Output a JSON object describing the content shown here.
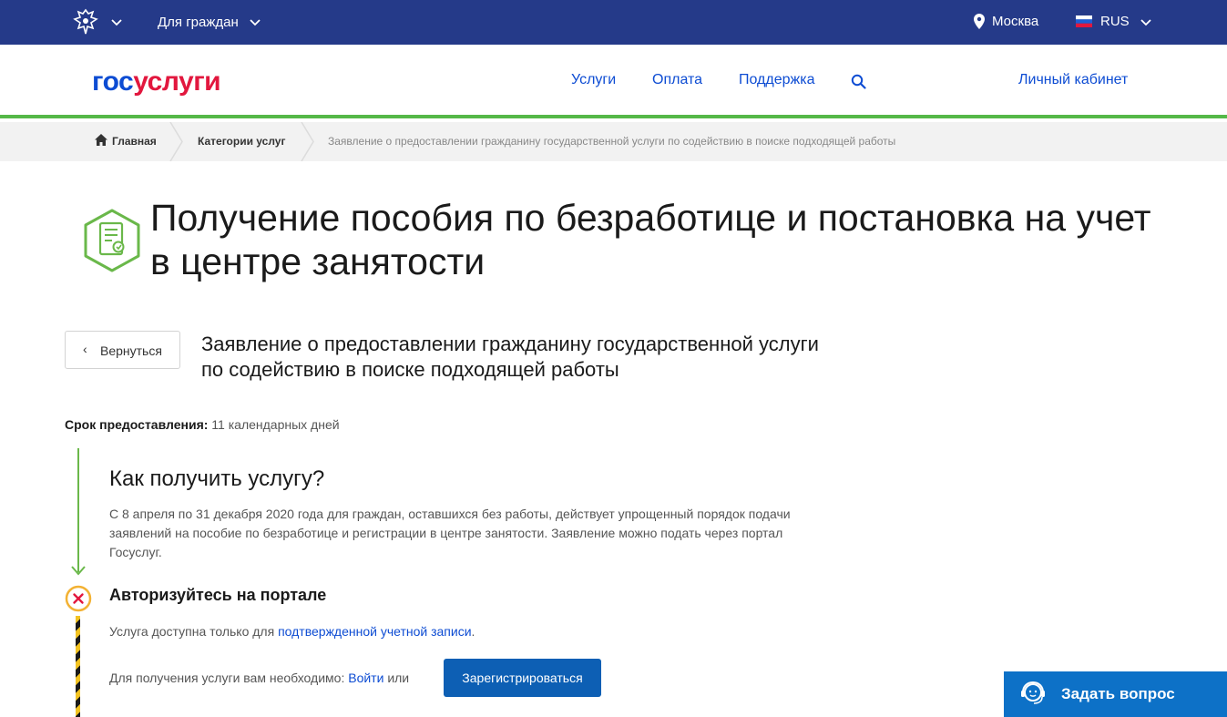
{
  "topbar": {
    "citizens_label": "Для граждан",
    "city": "Москва",
    "lang": "RUS"
  },
  "header": {
    "logo_part1": "гос",
    "logo_part2": "услуги",
    "nav": [
      "Услуги",
      "Оплата",
      "Поддержка"
    ],
    "cabinet": "Личный кабинет"
  },
  "breadcrumbs": {
    "home": "Главная",
    "categories": "Категории услуг",
    "current": "Заявление о предоставлении гражданину государственной услуги по содействию в поиске подходящей работы"
  },
  "page": {
    "title": "Получение пособия по безработице и постановка на учет в центре занятости",
    "back_label": "Вернуться",
    "subtitle": "Заявление о предоставлении гражданину государственной услуги по содействию в поиске подходящей работы",
    "term_label": "Срок предоставления:",
    "term_value": "11 календарных дней",
    "how_title": "Как получить услугу?",
    "how_text": "С 8 апреля по 31 декабря 2020 года для граждан, оставшихся без работы, действует упрощенный порядок подачи заявлений на пособие по безработице и регистрации в центре занятости. Заявление можно подать через портал Госуслуг.",
    "auth_title": "Авторизуйтесь на портале",
    "avail_text": "Услуга доступна только для",
    "avail_link": "подтвержденной учетной записи",
    "avail_end": ".",
    "need_text": "Для получения услуги вам необходимо:",
    "login_link": "Войти",
    "or_text": "или",
    "register_label": "Зарегистрироваться"
  },
  "ask": {
    "label": "Задать вопрос"
  },
  "colors": {
    "topbar": "#253a89",
    "accent_green": "#55b848",
    "link": "#0d4cd3",
    "button": "#0d5fb4"
  }
}
